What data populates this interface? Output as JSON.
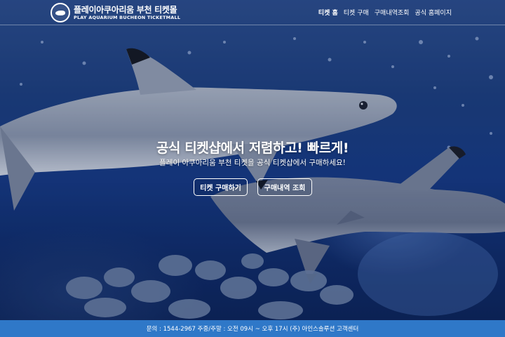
{
  "header": {
    "logo_kr": "플레이아쿠아리움 부천 티켓몰",
    "logo_en": "PLAY AQUARIUM BUCHEON TICKETMALL",
    "nav": [
      {
        "label": "티켓 홈",
        "active": true
      },
      {
        "label": "티켓 구매",
        "active": false
      },
      {
        "label": "구매내역조회",
        "active": false
      },
      {
        "label": "공식 홈페이지",
        "active": false
      }
    ]
  },
  "hero": {
    "headline": "공식 티켓샵에서 저렴하고! 빠르게!",
    "subline": "플레이 아쿠아리움 부천 티켓을 공식 티켓샵에서 구매하세요!",
    "buy_button": "티켓 구매하기",
    "history_button": "구매내역 조회"
  },
  "footer": {
    "text": "문의 : 1544-2967 주중/주말 : 오전 09시 ~ 오후 17시 (주) 아인스솔루션 고객센터"
  },
  "colors": {
    "footer_bg": "#2f78c8",
    "hero_blue": "#163a86",
    "text": "#ffffff"
  }
}
